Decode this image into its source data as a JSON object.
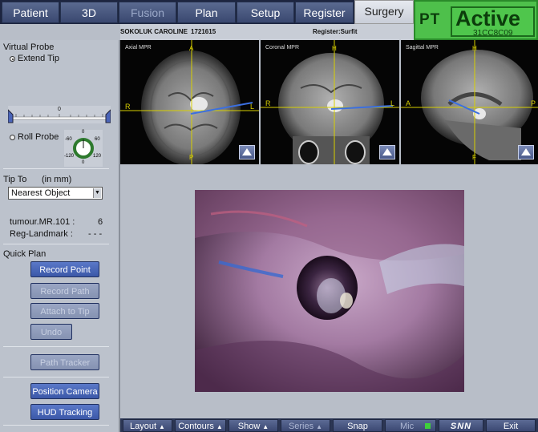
{
  "tabs": [
    {
      "label": "Patient"
    },
    {
      "label": "3D"
    },
    {
      "label": "Fusion"
    },
    {
      "label": "Plan"
    },
    {
      "label": "Setup"
    },
    {
      "label": "Register"
    },
    {
      "label": "Surgery"
    }
  ],
  "status": {
    "pt_label": "PT",
    "state": "Active",
    "code": "31CC8C09",
    "color": "#4ec04b"
  },
  "info": {
    "patient_name": "SOKOLUK CAROLINE",
    "patient_id": "1721615",
    "register": "Register:Surfit"
  },
  "left": {
    "virtual_probe": "Virtual Probe",
    "extend_tip": "Extend Tip",
    "slider_value": "0",
    "roll_probe": "Roll Probe",
    "dial_labels": {
      "top": "0",
      "left": "-60",
      "right": "60",
      "bottom_left": "-120",
      "bottom_right": "120",
      "bottom": "0"
    },
    "tip_to": "Tip To",
    "units": "(in mm)",
    "tip_target": "Nearest Object",
    "measure_label": "tumour.MR.101 :",
    "measure_value": "6",
    "reg_label": "Reg-Landmark :",
    "reg_value": "- - -",
    "quick_plan": "Quick Plan",
    "buttons": {
      "record_point": "Record Point",
      "record_path": "Record Path",
      "attach_tip": "Attach to Tip",
      "undo": "Undo",
      "path_tracker": "Path Tracker",
      "position_camera": "Position Camera",
      "hud_tracking": "HUD Tracking"
    }
  },
  "views": [
    {
      "title": "Axial MPR",
      "left": "R",
      "right": "L",
      "top": "A",
      "bottom": "P"
    },
    {
      "title": "Coronal MPR",
      "left": "R",
      "right": "L",
      "top": "H",
      "bottom": ""
    },
    {
      "title": "Sagittal MPR",
      "left": "A",
      "right": "P",
      "top": "H",
      "bottom": "F"
    }
  ],
  "bottom": {
    "layout": "Layout",
    "contours": "Contours",
    "show": "Show",
    "series": "Series",
    "snap": "Snap",
    "mic": "Mic",
    "logo": "SNN",
    "exit": "Exit"
  }
}
